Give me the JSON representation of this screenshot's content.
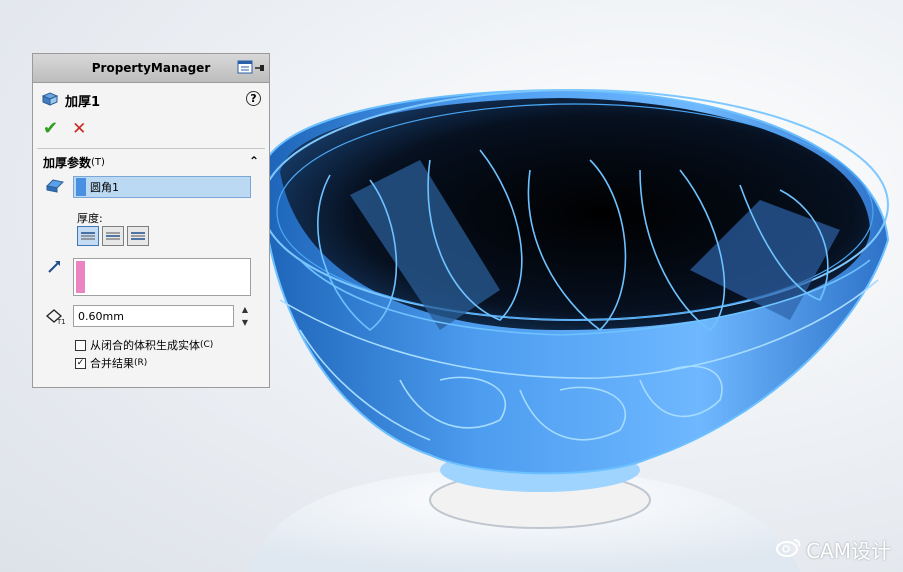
{
  "panel": {
    "title": "PropertyManager",
    "feature_name": "加厚1",
    "help_glyph": "?",
    "ok_glyph": "✔",
    "cancel_glyph": "✕",
    "section_title": "加厚参数",
    "section_shortcut": "(T)",
    "collapse_glyph": "⌃",
    "selection_value": "圆角1",
    "thickness_label": "厚度:",
    "thickness_value": "0.60mm",
    "spin_up": "▲",
    "spin_down": "▼",
    "checkbox_solid_label": "从闭合的体积生成实体",
    "checkbox_solid_shortcut": "(C)",
    "checkbox_solid_checked": false,
    "checkbox_merge_label": "合并结果",
    "checkbox_merge_shortcut": "(R)",
    "checkbox_merge_checked": true,
    "check_mark": "✓"
  },
  "colors": {
    "bowl_blue": "#3d8fe6",
    "bowl_edge": "#6cc0ff",
    "bowl_interior": "#050a14",
    "selection_swatch": "#4a90e2",
    "direction_swatch": "#ec84c2"
  },
  "watermark": {
    "text": "CAM设计"
  }
}
